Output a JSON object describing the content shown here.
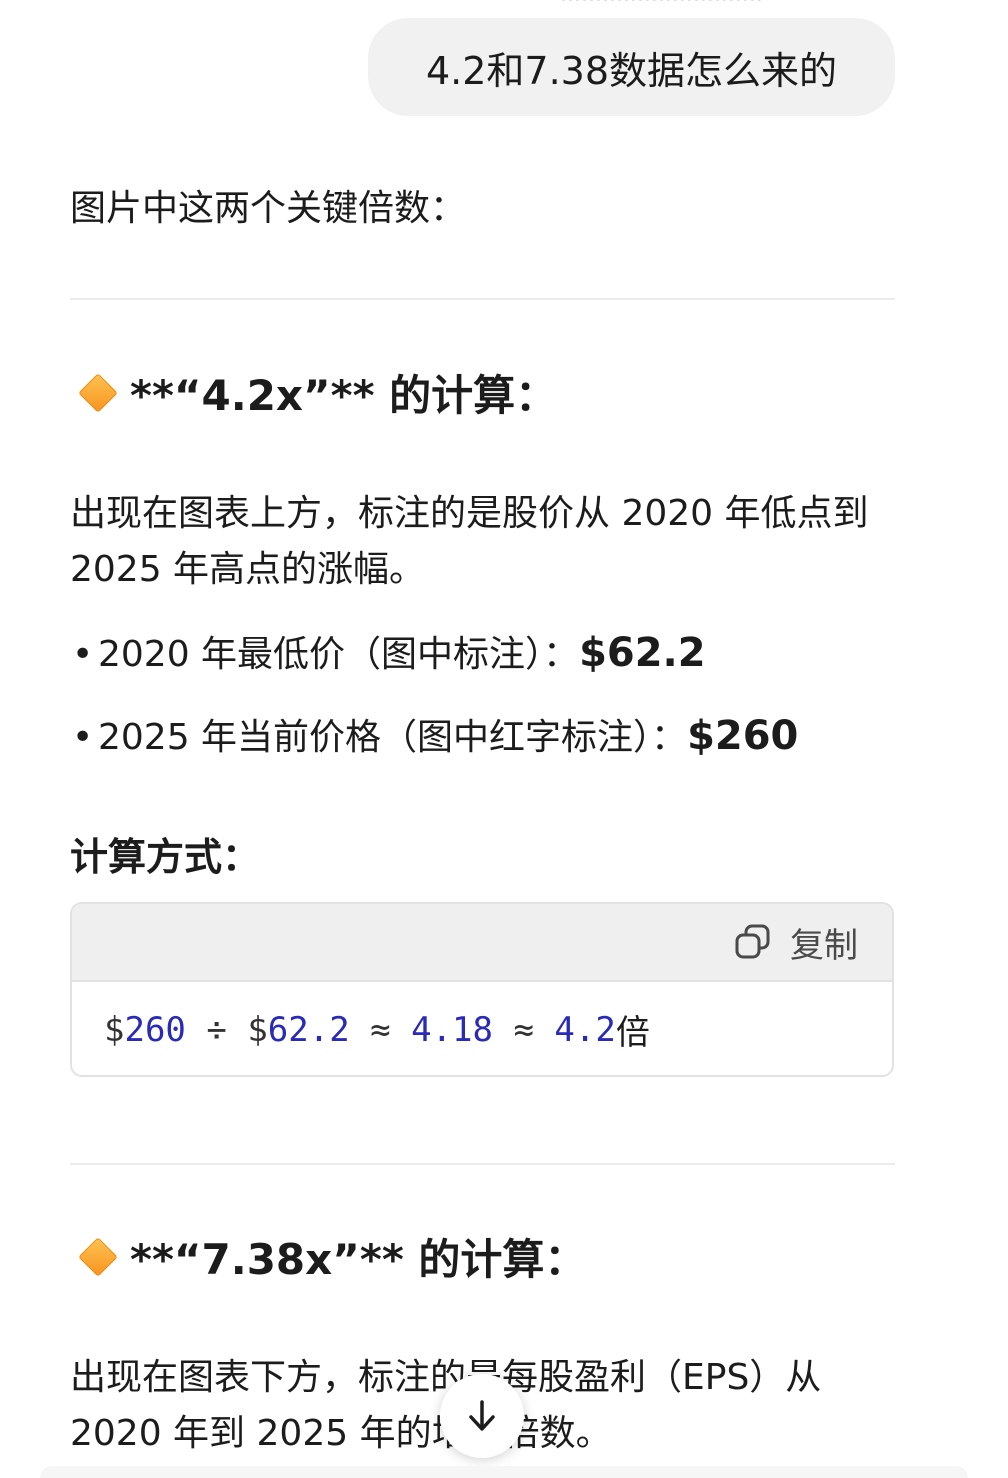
{
  "user_message": "4.2和7.38数据怎么来的",
  "answer": {
    "intro": "图片中这两个关键倍数：",
    "section1": {
      "heading": "**“4.2x”** 的计算：",
      "description": "出现在图表上方，标注的是股价从 2020 年低点到 2025 年高点的涨幅。",
      "bullets": [
        {
          "label": "2020 年最低价（图中标注）：",
          "value": "$62.2"
        },
        {
          "label": "2025 年当前价格（图中红字标注）：",
          "value": "$260"
        }
      ],
      "method_title": "计算方式：",
      "code": {
        "copy_label": "复制",
        "tokens": {
          "t1": "$",
          "t2": "260",
          "t3": " ÷ $",
          "t4": "62.2",
          "t5": " ≈ ",
          "t6": "4.18",
          "t7": " ≈ ",
          "t8": "4.2",
          "t9": "倍"
        }
      }
    },
    "section2": {
      "heading": "**“7.38x”** 的计算：",
      "description": "出现在图表下方，标注的是每股盈利（EPS）从 2020 年到 2025 年的增长倍数。"
    }
  },
  "icons": {
    "heading_marker": "orange-diamond-icon",
    "copy": "copy-icon",
    "scroll_down": "arrow-down-icon"
  },
  "colors": {
    "code_number": "#2a2ab8",
    "diamond": "#f7931e",
    "bubble_bg": "#f1f1f1"
  }
}
